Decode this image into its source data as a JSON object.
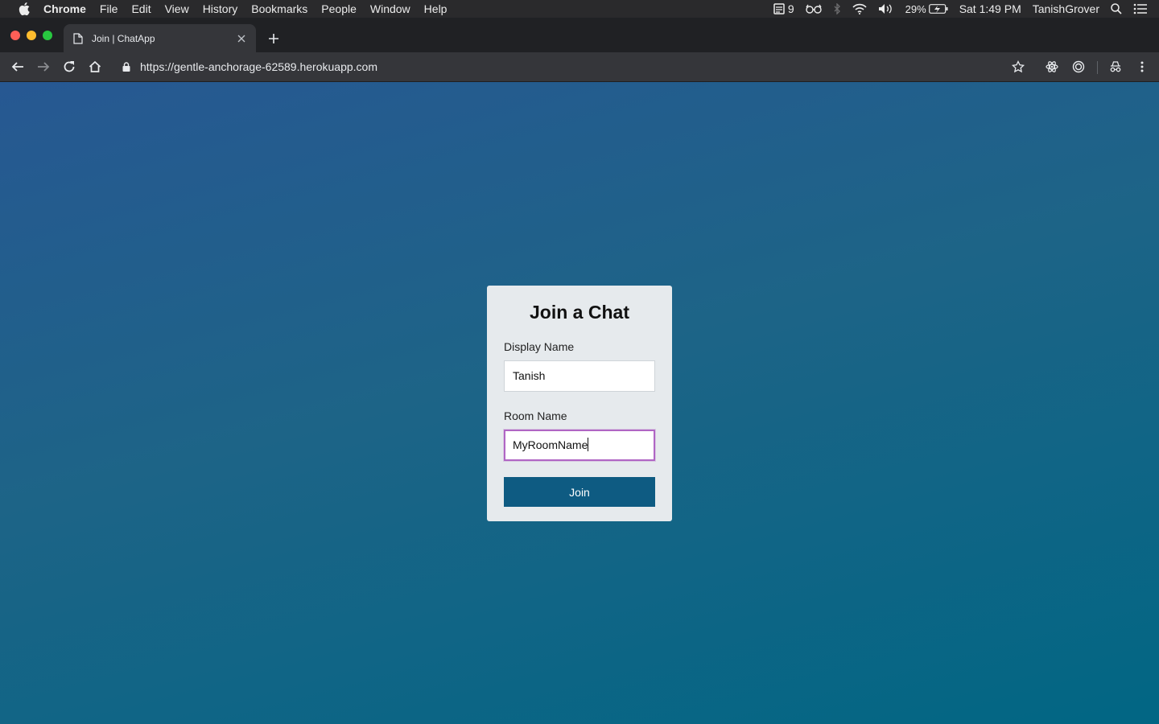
{
  "menubar": {
    "app_name": "Chrome",
    "menus": [
      "File",
      "Edit",
      "View",
      "History",
      "Bookmarks",
      "People",
      "Window",
      "Help"
    ],
    "status": {
      "notification_count": "9",
      "battery_percent": "29%",
      "clock": "Sat 1:49 PM",
      "user": "TanishGrover"
    }
  },
  "browser": {
    "tab_title": "Join | ChatApp",
    "url": "https://gentle-anchorage-62589.herokuapp.com"
  },
  "form": {
    "heading": "Join a Chat",
    "display_name_label": "Display Name",
    "display_name_value": "Tanish",
    "room_name_label": "Room Name",
    "room_name_value": "MyRoomName",
    "submit_label": "Join"
  },
  "colors": {
    "button": "#0e5b82",
    "focus_ring": "#b066c4",
    "page_gradient_start": "#275892",
    "page_gradient_end": "#016684"
  }
}
